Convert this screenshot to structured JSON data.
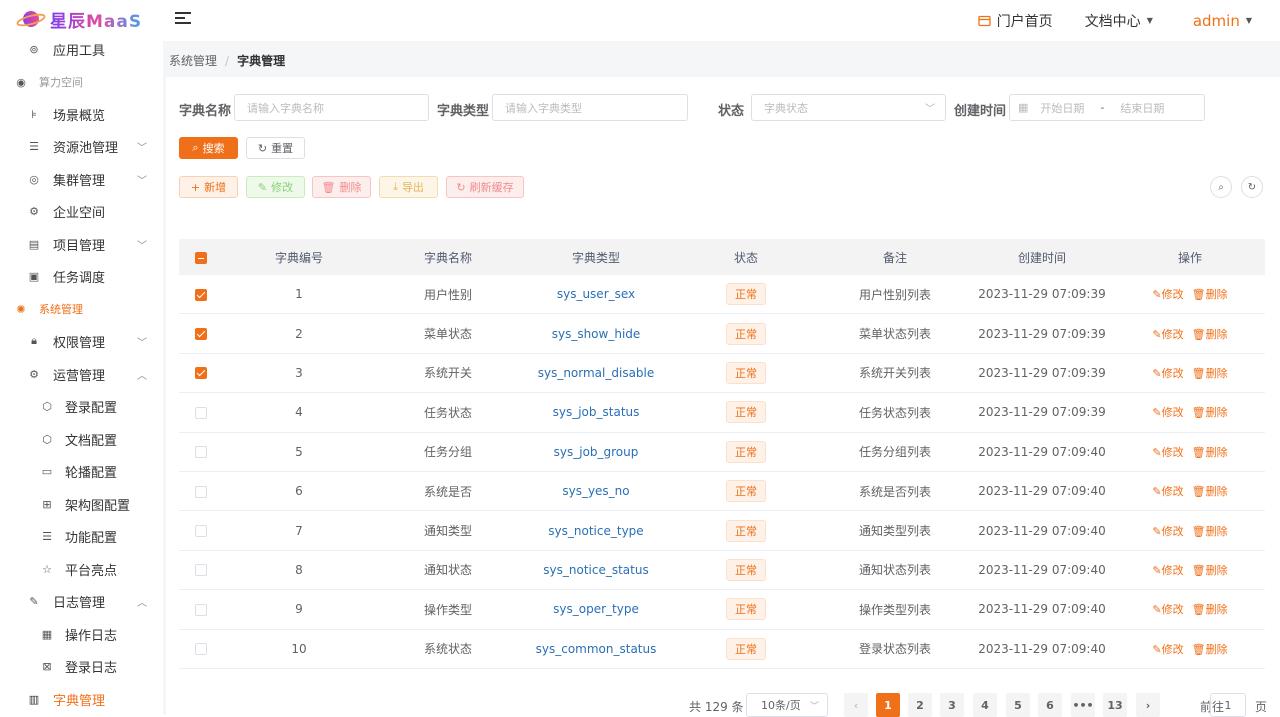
{
  "app": {
    "logo_text": "星辰MaaS"
  },
  "header": {
    "portal_label": "门户首页",
    "docs_label": "文档中心",
    "user_name": "admin"
  },
  "sidebar": {
    "items": [
      {
        "label": "应用工具"
      },
      {
        "label": "算力空间"
      },
      {
        "label": "场景概览"
      },
      {
        "label": "资源池管理"
      },
      {
        "label": "集群管理"
      },
      {
        "label": "企业空间"
      },
      {
        "label": "项目管理"
      },
      {
        "label": "任务调度"
      },
      {
        "label": "系统管理"
      },
      {
        "label": "权限管理"
      },
      {
        "label": "运营管理"
      },
      {
        "label": "登录配置"
      },
      {
        "label": "文档配置"
      },
      {
        "label": "轮播配置"
      },
      {
        "label": "架构图配置"
      },
      {
        "label": "功能配置"
      },
      {
        "label": "平台亮点"
      },
      {
        "label": "日志管理"
      },
      {
        "label": "操作日志"
      },
      {
        "label": "登录日志"
      },
      {
        "label": "字典管理"
      }
    ]
  },
  "breadcrumb": {
    "parent": "系统管理",
    "sep": "/",
    "current": "字典管理"
  },
  "filters": {
    "name_label": "字典名称",
    "name_placeholder": "请输入字典名称",
    "type_label": "字典类型",
    "type_placeholder": "请输入字典类型",
    "status_label": "状态",
    "status_placeholder": "字典状态",
    "time_label": "创建时间",
    "start_placeholder": "开始日期",
    "date_sep": "-",
    "end_placeholder": "结束日期",
    "search_label": "搜索",
    "reset_label": "重置"
  },
  "toolbar": {
    "add": "新增",
    "edit": "修改",
    "delete": "删除",
    "export": "导出",
    "refresh_cache": "刷新缓存"
  },
  "table": {
    "headers": [
      "字典编号",
      "字典名称",
      "字典类型",
      "状态",
      "备注",
      "创建时间",
      "操作"
    ],
    "edit_label": "修改",
    "delete_label": "删除",
    "rows": [
      {
        "id": "1",
        "name": "用户性别",
        "type": "sys_user_sex",
        "status": "正常",
        "remark": "用户性别列表",
        "time": "2023-11-29 07:09:39",
        "checked": true
      },
      {
        "id": "2",
        "name": "菜单状态",
        "type": "sys_show_hide",
        "status": "正常",
        "remark": "菜单状态列表",
        "time": "2023-11-29 07:09:39",
        "checked": true
      },
      {
        "id": "3",
        "name": "系统开关",
        "type": "sys_normal_disable",
        "status": "正常",
        "remark": "系统开关列表",
        "time": "2023-11-29 07:09:39",
        "checked": true
      },
      {
        "id": "4",
        "name": "任务状态",
        "type": "sys_job_status",
        "status": "正常",
        "remark": "任务状态列表",
        "time": "2023-11-29 07:09:39",
        "checked": false
      },
      {
        "id": "5",
        "name": "任务分组",
        "type": "sys_job_group",
        "status": "正常",
        "remark": "任务分组列表",
        "time": "2023-11-29 07:09:40",
        "checked": false
      },
      {
        "id": "6",
        "name": "系统是否",
        "type": "sys_yes_no",
        "status": "正常",
        "remark": "系统是否列表",
        "time": "2023-11-29 07:09:40",
        "checked": false
      },
      {
        "id": "7",
        "name": "通知类型",
        "type": "sys_notice_type",
        "status": "正常",
        "remark": "通知类型列表",
        "time": "2023-11-29 07:09:40",
        "checked": false
      },
      {
        "id": "8",
        "name": "通知状态",
        "type": "sys_notice_status",
        "status": "正常",
        "remark": "通知状态列表",
        "time": "2023-11-29 07:09:40",
        "checked": false
      },
      {
        "id": "9",
        "name": "操作类型",
        "type": "sys_oper_type",
        "status": "正常",
        "remark": "操作类型列表",
        "time": "2023-11-29 07:09:40",
        "checked": false
      },
      {
        "id": "10",
        "name": "系统状态",
        "type": "sys_common_status",
        "status": "正常",
        "remark": "登录状态列表",
        "time": "2023-11-29 07:09:40",
        "checked": false
      }
    ]
  },
  "pagination": {
    "total_text": "共 129 条",
    "page_size": "10条/页",
    "pages": [
      "1",
      "2",
      "3",
      "4",
      "5",
      "6",
      "•••",
      "13"
    ],
    "goto_prefix": "前往",
    "goto_value": "1",
    "goto_suffix": "页"
  },
  "colors": {
    "accent": "#f07019",
    "link": "#2a6fb5"
  }
}
